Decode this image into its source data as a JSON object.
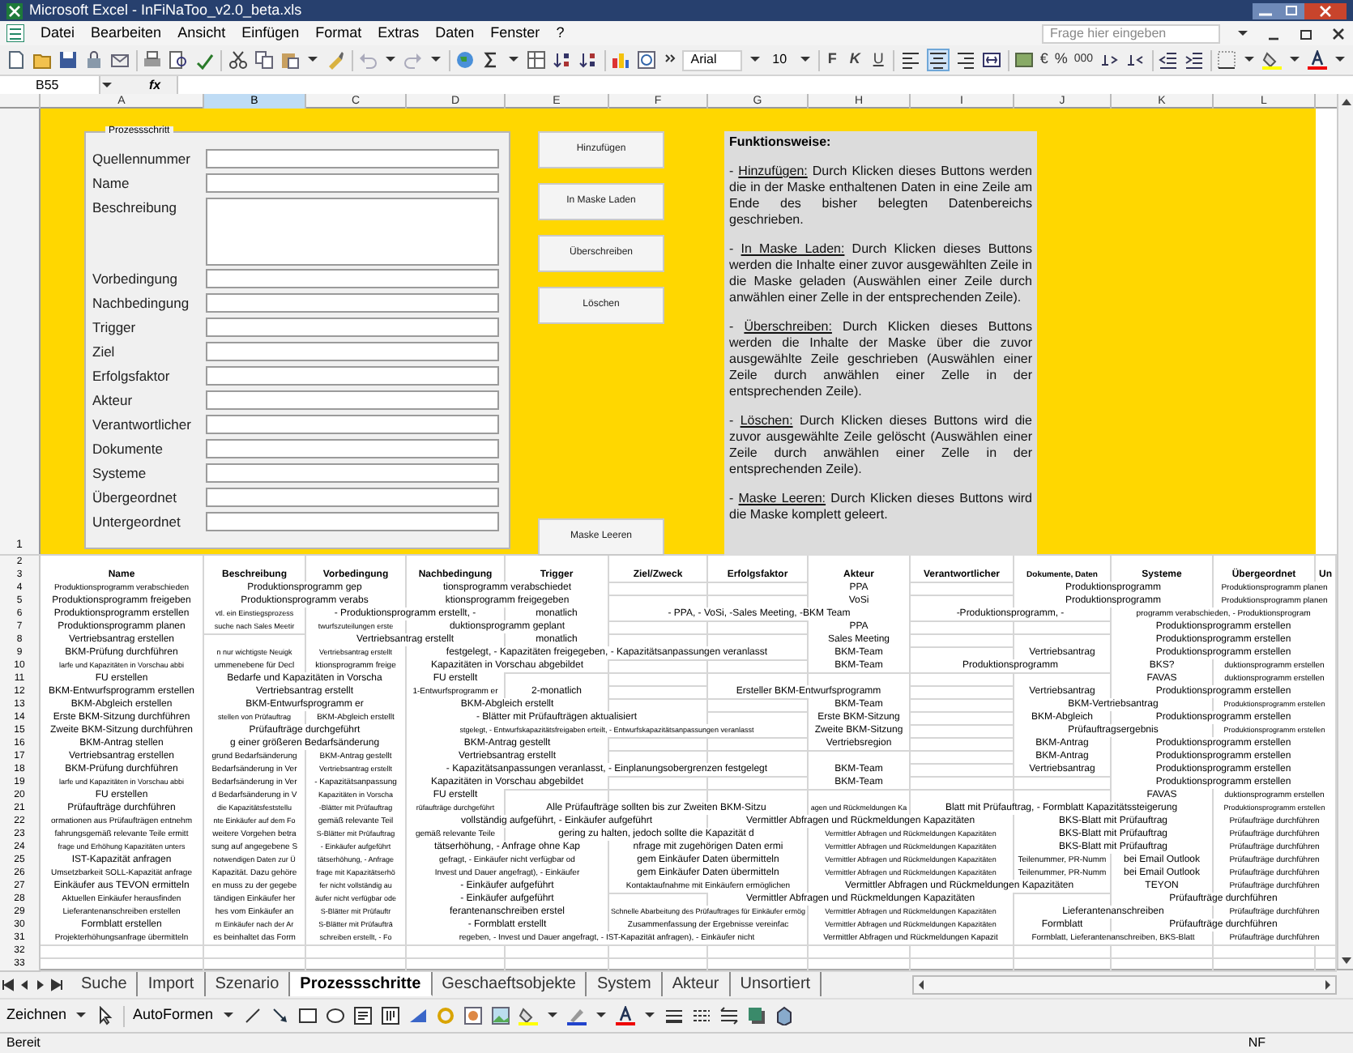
{
  "window": {
    "title": "Microsoft Excel - InFiNaToo_v2.0_beta.xls"
  },
  "menu": [
    "Datei",
    "Bearbeiten",
    "Ansicht",
    "Einfügen",
    "Format",
    "Extras",
    "Daten",
    "Fenster",
    "?"
  ],
  "help_box": {
    "placeholder": "Frage hier eingeben"
  },
  "toolbar": {
    "font": "Arial",
    "size": "10",
    "bold": "F",
    "italic": "K",
    "underline": "U",
    "currency": "€",
    "percent": "%",
    "thousands": "000"
  },
  "formula_bar": {
    "name_box": "B55",
    "fx": "fx"
  },
  "columns": [
    {
      "letter": "A",
      "selected": false
    },
    {
      "letter": "B",
      "selected": true
    },
    {
      "letter": "C",
      "selected": false
    },
    {
      "letter": "D",
      "selected": false
    },
    {
      "letter": "E",
      "selected": false
    },
    {
      "letter": "F",
      "selected": false
    },
    {
      "letter": "G",
      "selected": false
    },
    {
      "letter": "H",
      "selected": false
    },
    {
      "letter": "I",
      "selected": false
    },
    {
      "letter": "J",
      "selected": false
    },
    {
      "letter": "K",
      "selected": false
    },
    {
      "letter": "L",
      "selected": false
    }
  ],
  "form": {
    "number": "1",
    "legend": "Prozessschritt",
    "fields": [
      {
        "label": "Quellennummer",
        "kind": "line"
      },
      {
        "label": "Name",
        "kind": "line"
      },
      {
        "label": "Beschreibung",
        "kind": "area"
      },
      {
        "label": "Vorbedingung",
        "kind": "line"
      },
      {
        "label": "Nachbedingung",
        "kind": "line"
      },
      {
        "label": "Trigger",
        "kind": "line"
      },
      {
        "label": "Ziel",
        "kind": "line"
      },
      {
        "label": "Erfolgsfaktor",
        "kind": "line"
      },
      {
        "label": "Akteur",
        "kind": "line"
      },
      {
        "label": "Verantwortlicher",
        "kind": "line"
      },
      {
        "label": "Dokumente",
        "kind": "line"
      },
      {
        "label": "Systeme",
        "kind": "line"
      },
      {
        "label": "Übergeordnet",
        "kind": "line"
      },
      {
        "label": "Untergeordnet",
        "kind": "line"
      }
    ],
    "buttons": [
      "Hinzufügen",
      "In Maske Laden",
      "Überschreiben",
      "Löschen"
    ],
    "clear_button": "Maske Leeren",
    "help": {
      "title": "Funktionsweise:",
      "items": [
        {
          "dash": "-",
          "term": "Hinzufügen:",
          "text": "Durch Klicken dieses Buttons werden die in der Maske enthaltenen Daten in eine Zeile am Ende des bisher belegten Datenbereichs geschrieben."
        },
        {
          "dash": "-",
          "term": "In Maske Laden:",
          "text": "Durch Klicken dieses Buttons werden die Inhalte einer zuvor ausgewählten Zeile in die Maske geladen (Auswählen einer Zeile durch anwählen einer Zelle in der entsprechenden Zeile)."
        },
        {
          "dash": "-",
          "term": "Überschreiben:",
          "text": "Durch Klicken dieses Buttons werden die Inhalte der Maske über die zuvor ausgewählte Zeile geschrieben (Auswählen einer Zeile durch anwählen einer Zelle in der entsprechenden Zeile)."
        },
        {
          "dash": "-",
          "term": "Löschen:",
          "text": "Durch Klicken dieses Buttons wird die zuvor ausgewählte Zeile gelöscht (Auswählen einer Zeile durch anwählen einer Zelle in der entsprechenden Zeile)."
        },
        {
          "dash": "-",
          "term": "Maske Leeren:",
          "text": "Durch Klicken dieses Buttons wird die Maske komplett geleert."
        }
      ]
    }
  },
  "table": {
    "rows": [
      {
        "number": "2",
        "kind": "blank"
      },
      {
        "number": "3",
        "kind": "header",
        "cells": [
          "Name",
          "Beschreibung",
          "Vorbedingung",
          "Nachbedingung",
          "Trigger",
          "Ziel/Zweck",
          "Erfolgsfaktor",
          "Akteur",
          "Verantwortlicher",
          "Dokumente, Daten",
          "Systeme",
          "Übergeordnet",
          "Un"
        ]
      },
      {
        "number": "4",
        "kind": "data",
        "cells": [
          "Produktionsprogramm verabschieden",
          "Produktionsprogramm gep",
          "",
          "tionsprogramm verabschiedet",
          "",
          "",
          "",
          "PPA",
          "",
          "Produktionsprogramm",
          "",
          "Produktionsprogramm planen"
        ]
      },
      {
        "number": "5",
        "kind": "data",
        "cells": [
          "Produktionsprogramm freigeben",
          "Produktionsprogramm verabs",
          "",
          "ktionsprogramm freigegeben",
          "",
          "",
          "",
          "VoSi",
          "",
          "Produktionsprogramm",
          "",
          "Produktionsprogramm planen"
        ]
      },
      {
        "number": "6",
        "kind": "data",
        "cells": [
          "Produktionsprogramm erstellen",
          "vtl. ein Einstiegsprozess",
          "- Produktionsprogramm erstellt, -",
          "",
          "monatlich",
          "",
          "- PPA, - VoSi, -Sales Meeting, -BKM Team",
          "",
          "",
          "-Produktionsprogramm, -",
          "programm verabschieden, - Produktionsprogram"
        ]
      },
      {
        "number": "7",
        "kind": "data",
        "cells": [
          "Produktionsprogramm planen",
          "suche nach Sales Meetir",
          "twurfszuteilungen erste",
          "duktionsprogramm geplant",
          "",
          "",
          "",
          "PPA",
          "",
          "",
          "",
          "Produktionsprogramm erstellen"
        ]
      },
      {
        "number": "8",
        "kind": "data",
        "cells": [
          "Vertriebsantrag erstellen",
          "",
          "",
          "Vertriebsantrag erstellt",
          "monatlich",
          "",
          "",
          "Sales Meeting",
          "",
          "",
          "",
          "Produktionsprogramm erstellen"
        ]
      },
      {
        "number": "9",
        "kind": "data",
        "cells": [
          "BKM-Prüfung durchführen",
          "n nur wichtigste Neuigk",
          "Vertriebsantrag erstellt",
          "festgelegt, - Kapazitäten freigegeben, - Kapazitätsanpassungen veranlasst",
          "",
          "",
          "",
          "BKM-Team",
          "",
          "Vertriebsantrag",
          "",
          "Produktionsprogramm erstellen"
        ]
      },
      {
        "number": "10",
        "kind": "data",
        "cells": [
          "larfe und Kapazitäten in Vorschau abbi",
          "ummenebene für Decl",
          "ktionsprogramm freige",
          "Kapazitäten in Vorschau abgebildet",
          "",
          "",
          "",
          "BKM-Team",
          "",
          "Produktionsprogramm",
          "BKS?",
          "duktionsprogramm erstellen"
        ]
      },
      {
        "number": "11",
        "kind": "data",
        "cells": [
          "FU erstellen",
          "Bedarfe und Kapazitäten in Vorscha",
          "",
          "FU erstellt",
          "",
          "",
          "",
          "",
          "",
          "",
          "FAVAS",
          "duktionsprogramm erstellen"
        ]
      },
      {
        "number": "12",
        "kind": "data",
        "cells": [
          "BKM-Entwurfsprogramm erstellen",
          "",
          "Vertriebsantrag erstellt",
          "1-Entwurfsprogramm er",
          "2-monatlich",
          "",
          "Ersteller BKM-Entwurfsprogramm",
          "",
          "",
          "Vertriebsantrag",
          "",
          "Produktionsprogramm erstellen"
        ]
      },
      {
        "number": "13",
        "kind": "data",
        "cells": [
          "BKM-Abgleich erstellen",
          "",
          "BKM-Entwurfsprogramm er",
          "BKM-Abgleich erstellt",
          "",
          "",
          "",
          "BKM-Team",
          "",
          "BKM-Vertriebsantrag",
          "",
          "Produktionsprogramm erstellen"
        ]
      },
      {
        "number": "14",
        "kind": "data",
        "cells": [
          "Erste BKM-Sitzung durchführen",
          "stellen von Prüfauftrag",
          "BKM-Abgleich erstellt",
          "- Blätter mit Prüfaufträgen aktualisiert",
          "",
          "",
          "",
          "Erste BKM-Sitzung",
          "",
          "BKM-Abgleich",
          "",
          "Produktionsprogramm erstellen"
        ]
      },
      {
        "number": "15",
        "kind": "data",
        "cells": [
          "Zweite BKM-Sitzung durchführen",
          "",
          "Prüfaufträge durchgeführt",
          "stgelegt, - Entwurfskapazitätsfreigaben erteilt, - Entwurfskapazitätsanpassungen veranlasst",
          "",
          "",
          "",
          "Zweite BKM-Sitzung",
          "",
          "Prüfauftragsergebnis",
          "",
          "Produktionsprogramm erstellen"
        ]
      },
      {
        "number": "16",
        "kind": "data",
        "cells": [
          "BKM-Antrag stellen",
          "g einer größeren Bedarfsänderung",
          "",
          "BKM-Antrag gestellt",
          "",
          "",
          "",
          "Vertriebsregion",
          "",
          "BKM-Antrag",
          "",
          "Produktionsprogramm erstellen"
        ]
      },
      {
        "number": "17",
        "kind": "data",
        "cells": [
          "Vertriebsantrag erstellen",
          "grund Bedarfsänderung",
          "BKM-Antrag gestellt",
          "Vertriebsantrag erstellt",
          "",
          "",
          "",
          "",
          "",
          "BKM-Antrag",
          "",
          "Produktionsprogramm erstellen"
        ]
      },
      {
        "number": "18",
        "kind": "data",
        "cells": [
          "BKM-Prüfung durchführen",
          "Bedarfsänderung in Ver",
          "Vertriebsantrag erstellt",
          "- Kapazitätsanpassungen veranlasst, - Einplanungsobergrenzen festgelegt",
          "",
          "",
          "",
          "BKM-Team",
          "",
          "Vertriebsantrag",
          "",
          "Produktionsprogramm erstellen"
        ]
      },
      {
        "number": "19",
        "kind": "data",
        "cells": [
          "larfe und Kapazitäten in Vorschau abbi",
          "Bedarfsänderung in Ver",
          "- Kapazitätsanpassung",
          "Kapazitäten in Vorschau abgebildet",
          "",
          "",
          "",
          "BKM-Team",
          "",
          "",
          "",
          "Produktionsprogramm erstellen"
        ]
      },
      {
        "number": "20",
        "kind": "data",
        "cells": [
          "FU erstellen",
          "d Bedarfsänderung in V",
          "Kapazitäten in Vorscha",
          "FU erstellt",
          "",
          "",
          "",
          "",
          "",
          "",
          "FAVAS",
          "duktionsprogramm erstellen"
        ]
      },
      {
        "number": "21",
        "kind": "data",
        "cells": [
          "Prüfaufträge durchführen",
          "die Kapazitätsfeststellu",
          "-Blätter mit Prüfauftrag",
          "rüfaufträge durchgeführt",
          "Alle Prüfaufträge sollten bis zur Zweiten BKM-Sitzu",
          "",
          "",
          "agen und Rückmeldungen Ka",
          "Blatt mit Prüfauftrag, - Formblatt Kapazitätssteigerung",
          "",
          "",
          "Produktionsprogramm erstellen"
        ]
      },
      {
        "number": "22",
        "kind": "data",
        "cells": [
          "ormationen aus Prüfaufträgen entnehm",
          "nte Einkäufer auf dem Fo",
          "gemäß relevante Teil",
          "vollständig aufgeführt, - Einkäufer aufgeführt",
          "",
          "",
          "",
          "Vermittler Abfragen und Rückmeldungen Kapazitäten",
          "",
          "BKS-Blatt mit Prüfauftrag",
          "",
          "Prüfaufträge durchführen"
        ]
      },
      {
        "number": "23",
        "kind": "data",
        "cells": [
          "fahrungsgemäß relevante Teile ermitt",
          "weitere Vorgehen betra",
          "S-Blätter mit Prüfauftrag",
          "gemäß relevante Teile",
          "gering zu halten, jedoch sollte die Kapazität d",
          "",
          "",
          "Vermittler Abfragen und Rückmeldungen Kapazitäten",
          "",
          "BKS-Blatt mit Prüfauftrag",
          "",
          "Prüfaufträge durchführen"
        ]
      },
      {
        "number": "24",
        "kind": "data",
        "cells": [
          "frage und Erhöhung Kapazitäten unters",
          "sung auf angegebene S",
          "- Einkäufer aufgeführt",
          "tätserhöhung, - Anfrage ohne Kap",
          "",
          "nfrage mit zugehörigen Daten ermi",
          "",
          "Vermittler Abfragen und Rückmeldungen Kapazitäten",
          "",
          "BKS-Blatt mit Prüfauftrag",
          "",
          "Prüfaufträge durchführen"
        ]
      },
      {
        "number": "25",
        "kind": "data",
        "cells": [
          "IST-Kapazität anfragen",
          "notwendigen Daten zur Ü",
          "tätserhöhung, - Anfrage",
          "gefragt, - Einkäufer nicht verfügbar od",
          "",
          "gem Einkäufer Daten übermitteln",
          "",
          "Vermittler Abfragen und Rückmeldungen Kapazitäten",
          "",
          "Teilenummer, PR-Numm",
          "bei Email Outlook",
          "Prüfaufträge durchführen"
        ]
      },
      {
        "number": "26",
        "kind": "data",
        "cells": [
          "Umsetzbarkeit SOLL-Kapazität anfrage",
          "Kapazität. Dazu gehöre",
          "frage mit Kapazitätserhö",
          "Invest und Dauer angefragt), - Einkäufer",
          "",
          "gem Einkäufer Daten übermitteln",
          "",
          "Vermittler Abfragen und Rückmeldungen Kapazitäten",
          "",
          "Teilenummer, PR-Numm",
          "bei Email Outlook",
          "Prüfaufträge durchführen"
        ]
      },
      {
        "number": "27",
        "kind": "data",
        "cells": [
          "Einkäufer aus TEVON ermitteln",
          "en muss zu der gegebe",
          "fer nicht vollständig au",
          "- Einkäufer aufgeführt",
          "",
          "Kontaktaufnahme mit Einkäufern ermöglichen",
          "",
          "Vermittler Abfragen und Rückmeldungen Kapazitäten",
          "",
          "",
          "TEYON",
          "Prüfaufträge durchführen"
        ]
      },
      {
        "number": "28",
        "kind": "data",
        "cells": [
          "Aktuellen Einkäufer herausfinden",
          "tändigen Einkäufer her",
          "äufer nicht verfügbar ode",
          "- Einkäufer aufgeführt",
          "",
          "",
          "",
          "Vermittler Abfragen und Rückmeldungen Kapazitäten",
          "",
          "",
          "",
          "Prüfaufträge durchführen"
        ]
      },
      {
        "number": "29",
        "kind": "data",
        "cells": [
          "Lieferantenanschreiben erstellen",
          "hes vom Einkäufer an",
          "S-Blätter mit Prüfauftr",
          "ferantenanschreiben erstel",
          "",
          "Schnelle Abarbeitung des Prüfauftrages für Einkäufer ermög",
          "",
          "Vermittler Abfragen und Rückmeldungen Kapazitäten",
          "",
          "Lieferantenanschreiben",
          "",
          "Prüfaufträge durchführen"
        ]
      },
      {
        "number": "30",
        "kind": "data",
        "cells": [
          "Formblatt erstellen",
          "m Einkäufer nach der Ar",
          "S-Blätter mit Prüfauftrā",
          "- Formblatt erstellt",
          "",
          "Zusammenfassung der Ergebnisse vereinfac",
          "",
          "Vermittler Abfragen und Rückmeldungen Kapazitäten",
          "",
          "Formblatt",
          "",
          "Prüfaufträge durchführen"
        ]
      },
      {
        "number": "31",
        "kind": "data",
        "cells": [
          "Projekterhöhungsanfrage übermitteln",
          "es beinhaltet das Form",
          "schreiben erstellt, - Fo",
          "regeben, - Invest und Dauer angefragt, - IST-Kapazität anfragen), - Einkäufer nicht",
          "",
          "",
          "",
          "Vermittler Abfragen und Rückmeldungen Kapazit",
          "",
          "Formblatt, Lieferantenanschreiben, BKS-Blatt",
          "",
          "Prüfaufträge durchführen"
        ]
      },
      {
        "number": "32",
        "kind": "blank"
      },
      {
        "number": "33",
        "kind": "blank"
      }
    ]
  },
  "sheet_tabs": [
    {
      "label": "Suche",
      "selected": false
    },
    {
      "label": "Import",
      "selected": false
    },
    {
      "label": "Szenario",
      "selected": false
    },
    {
      "label": "Prozessschritte",
      "selected": true
    },
    {
      "label": "Geschaeftsobjekte",
      "selected": false
    },
    {
      "label": "System",
      "selected": false
    },
    {
      "label": "Akteur",
      "selected": false
    },
    {
      "label": "Unsortiert",
      "selected": false
    }
  ],
  "drawing_toolbar": {
    "draw_menu": "Zeichnen",
    "autoshapes_menu": "AutoFormen"
  },
  "status_bar": {
    "left": "Bereit",
    "right": "NF"
  }
}
